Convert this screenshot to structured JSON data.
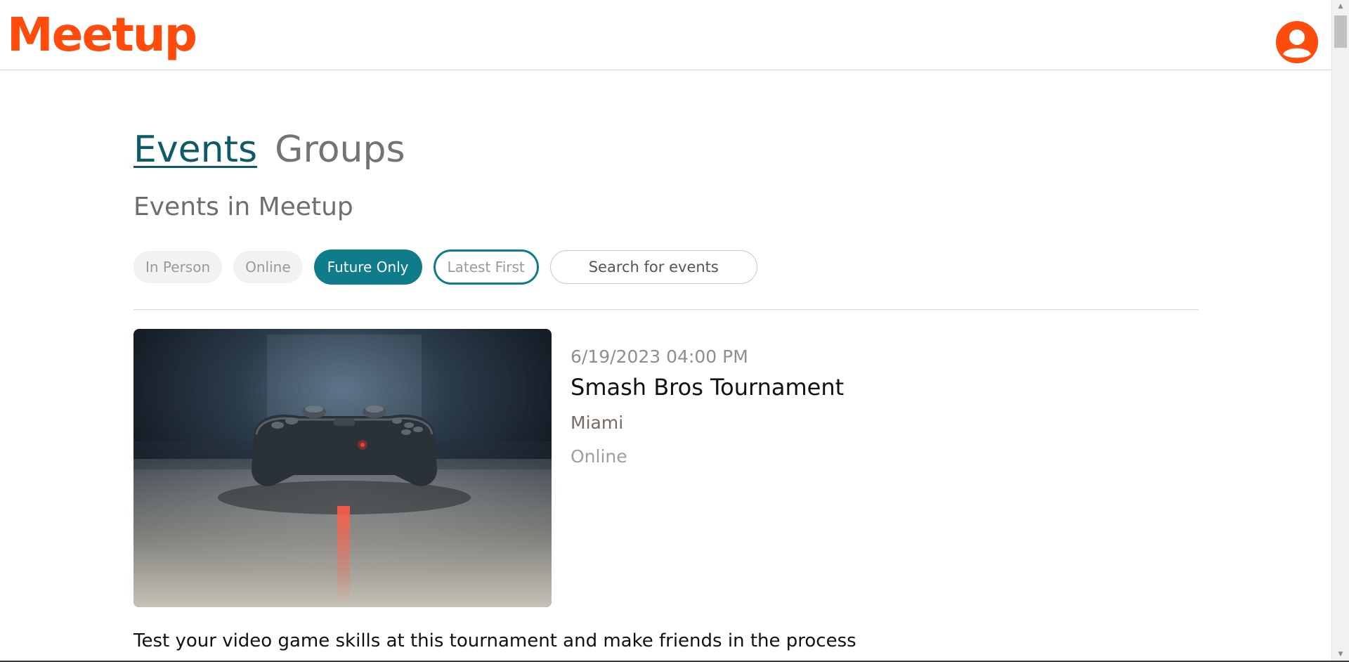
{
  "header": {
    "logo": "Meetup",
    "profile_icon": "user-circle-icon",
    "brand_color": "#ff4b0c"
  },
  "nav": {
    "tabs": [
      {
        "label": "Events",
        "active": true
      },
      {
        "label": "Groups",
        "active": false
      }
    ]
  },
  "page": {
    "subtitle": "Events in Meetup"
  },
  "filters": {
    "in_person": "In Person",
    "online": "Online",
    "future_only": "Future Only",
    "latest_first": "Latest First",
    "search_placeholder": "Search for events",
    "accent_color": "#0e7c8a"
  },
  "events": [
    {
      "date": "6/19/2023 04:00 PM",
      "title": "Smash Bros Tournament",
      "location": "Miami",
      "type": "Online",
      "description": "Test your video game skills at this tournament and make friends in the process",
      "image": "game-controller-photo"
    }
  ]
}
